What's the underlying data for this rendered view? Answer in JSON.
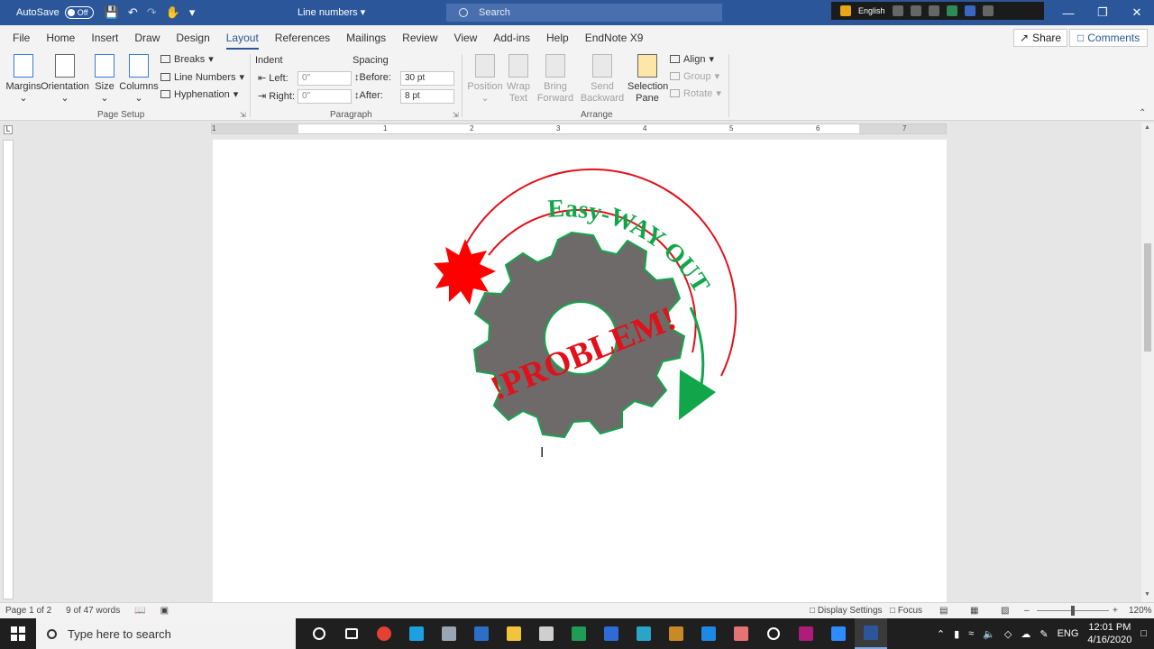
{
  "titlebar": {
    "autosave_label": "AutoSave",
    "autosave_state": "Off",
    "doc_title": "Line numbers",
    "search_placeholder": "Search",
    "language": "English"
  },
  "tabs": [
    "File",
    "Home",
    "Insert",
    "Draw",
    "Design",
    "Layout",
    "References",
    "Mailings",
    "Review",
    "View",
    "Add-ins",
    "Help",
    "EndNote X9"
  ],
  "active_tab": "Layout",
  "share_label": "Share",
  "comments_label": "Comments",
  "ribbon": {
    "page_setup": {
      "margins": "Margins",
      "orientation": "Orientation",
      "size": "Size",
      "columns": "Columns",
      "breaks": "Breaks",
      "line_numbers": "Line Numbers",
      "hyphenation": "Hyphenation",
      "group_label": "Page Setup"
    },
    "paragraph": {
      "indent_header": "Indent",
      "spacing_header": "Spacing",
      "left_label": "Left:",
      "left_value": "0\"",
      "right_label": "Right:",
      "right_value": "0\"",
      "before_label": "Before:",
      "before_value": "30 pt",
      "after_label": "After:",
      "after_value": "8 pt",
      "group_label": "Paragraph"
    },
    "arrange": {
      "position": "Position",
      "wrap_text": "Wrap Text",
      "bring_forward": "Bring Forward",
      "send_backward": "Send Backward",
      "selection_pane": "Selection Pane",
      "align": "Align",
      "group": "Group",
      "rotate": "Rotate",
      "group_label": "Arrange"
    }
  },
  "ruler_numbers": [
    "1",
    "1",
    "2",
    "3",
    "4",
    "5",
    "6",
    "7"
  ],
  "logo": {
    "arc_text": "Easy-WAY OUT",
    "center_text": "!PROBLEM!"
  },
  "statusbar": {
    "page": "Page 1 of 2",
    "words": "9 of 47 words",
    "display_settings": "Display Settings",
    "focus": "Focus",
    "zoom": "120%"
  },
  "taskbar": {
    "search_placeholder": "Type here to search",
    "lang": "ENG",
    "time": "12:01 PM",
    "date": "4/16/2020"
  }
}
